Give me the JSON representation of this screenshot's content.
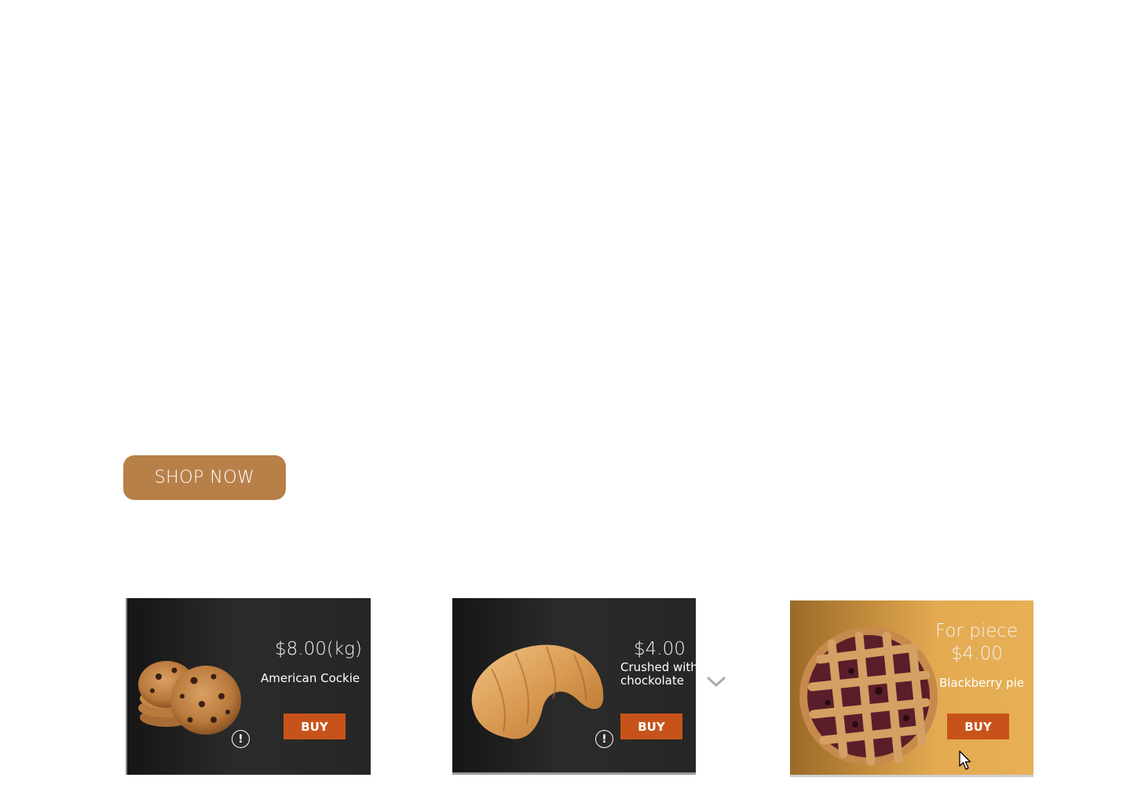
{
  "hero": {
    "cta_label": "SHOP NOW"
  },
  "products": [
    {
      "price": "$8.00(kg)",
      "name": "American Cockie",
      "buy_label": "BUY",
      "info_glyph": "!"
    },
    {
      "price": "$4.00",
      "name_line1": "Crushed with",
      "name_line2": "chockolate",
      "buy_label": "BUY",
      "info_glyph": "!"
    },
    {
      "price_line1": "For piece",
      "price_line2": "$4.00",
      "name": "Blackberry pie",
      "buy_label": "BUY"
    }
  ],
  "icons": {
    "next": "chevron-down-icon",
    "info": "info-icon",
    "pointer": "mouse-pointer-icon"
  },
  "colors": {
    "cta": "#b88049",
    "buy": "#c8531a",
    "card_dark": "#262626",
    "card_pie": "#e3aa52"
  }
}
